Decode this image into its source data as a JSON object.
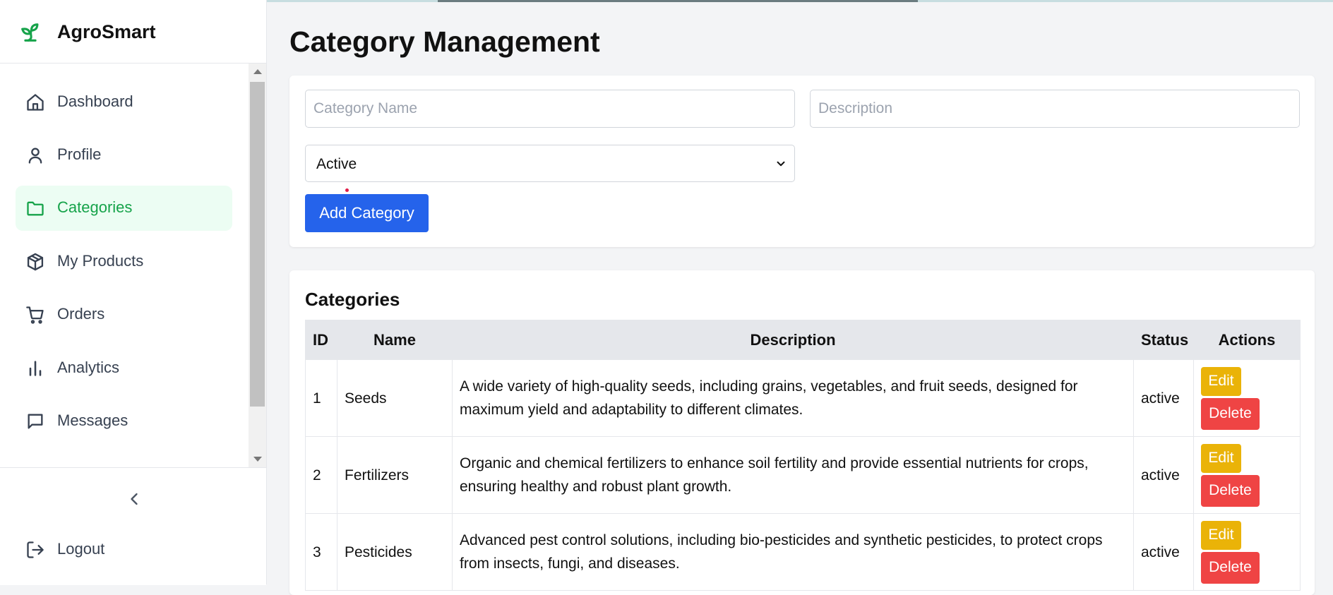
{
  "app": {
    "name": "AgroSmart",
    "logo_icon": "sprout-icon",
    "accent": "#16a34a"
  },
  "sidebar": {
    "items": [
      {
        "label": "Dashboard",
        "icon": "home-icon",
        "active": false
      },
      {
        "label": "Profile",
        "icon": "user-icon",
        "active": false
      },
      {
        "label": "Categories",
        "icon": "folder-icon",
        "active": true
      },
      {
        "label": "My Products",
        "icon": "package-icon",
        "active": false
      },
      {
        "label": "Orders",
        "icon": "cart-icon",
        "active": false
      },
      {
        "label": "Analytics",
        "icon": "bar-chart-icon",
        "active": false
      },
      {
        "label": "Messages",
        "icon": "message-icon",
        "active": false
      }
    ],
    "collapse_icon": "chevron-left-icon",
    "logout_label": "Logout",
    "logout_icon": "logout-icon"
  },
  "page": {
    "title": "Category Management"
  },
  "form": {
    "name_placeholder": "Category Name",
    "name_value": "",
    "description_placeholder": "Description",
    "description_value": "",
    "status_selected": "Active",
    "add_label": "Add Category",
    "add_color": "#2563eb"
  },
  "list": {
    "title": "Categories",
    "columns": [
      "ID",
      "Name",
      "Description",
      "Status",
      "Actions"
    ],
    "rows": [
      {
        "id": "1",
        "name": "Seeds",
        "description": "A wide variety of high-quality seeds, including grains, vegetables, and fruit seeds, designed for maximum yield and adaptability to different climates.",
        "status": "active"
      },
      {
        "id": "2",
        "name": "Fertilizers",
        "description": "Organic and chemical fertilizers to enhance soil fertility and provide essential nutrients for crops, ensuring healthy and robust plant growth.",
        "status": "active"
      },
      {
        "id": "3",
        "name": "Pesticides",
        "description": "Advanced pest control solutions, including bio-pesticides and synthetic pesticides, to protect crops from insects, fungi, and diseases.",
        "status": "active"
      }
    ],
    "edit_label": "Edit",
    "delete_label": "Delete",
    "edit_color": "#eab308",
    "delete_color": "#ef4444"
  }
}
